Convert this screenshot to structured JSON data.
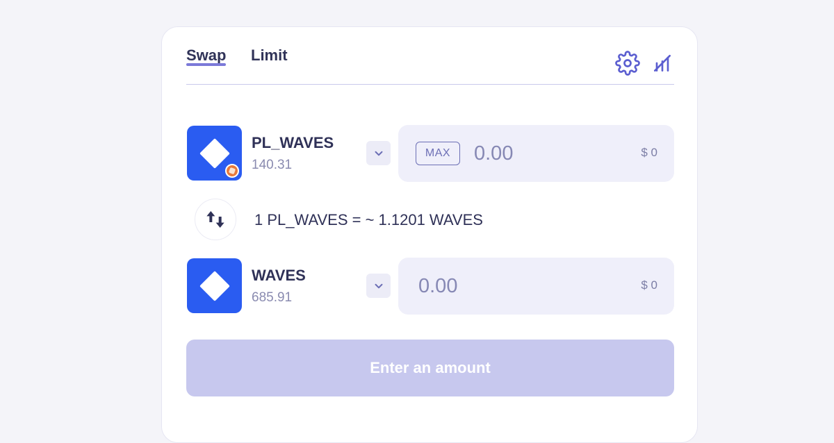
{
  "tabs": [
    {
      "label": "Swap",
      "active": true
    },
    {
      "label": "Limit",
      "active": false
    }
  ],
  "header_icons": [
    "gear-icon",
    "chart-off-icon"
  ],
  "from_token": {
    "name": "PL_WAVES",
    "balance": "140.31",
    "amount_placeholder": "0.00",
    "max_label": "MAX",
    "usd_value": "$ 0",
    "logo_color": "#2a5cf1",
    "badge_color": "#e8793a"
  },
  "rate": {
    "text": "1 PL_WAVES = ~ 1.1201 WAVES"
  },
  "to_token": {
    "name": "WAVES",
    "balance": "685.91",
    "amount_placeholder": "0.00",
    "usd_value": "$ 0",
    "logo_color": "#2a5cf1"
  },
  "submit_label": "Enter an amount",
  "colors": {
    "accent": "#7b79d8",
    "text": "#2f3157",
    "input_bg": "#efeffa",
    "button_disabled": "#c7c8ee"
  }
}
